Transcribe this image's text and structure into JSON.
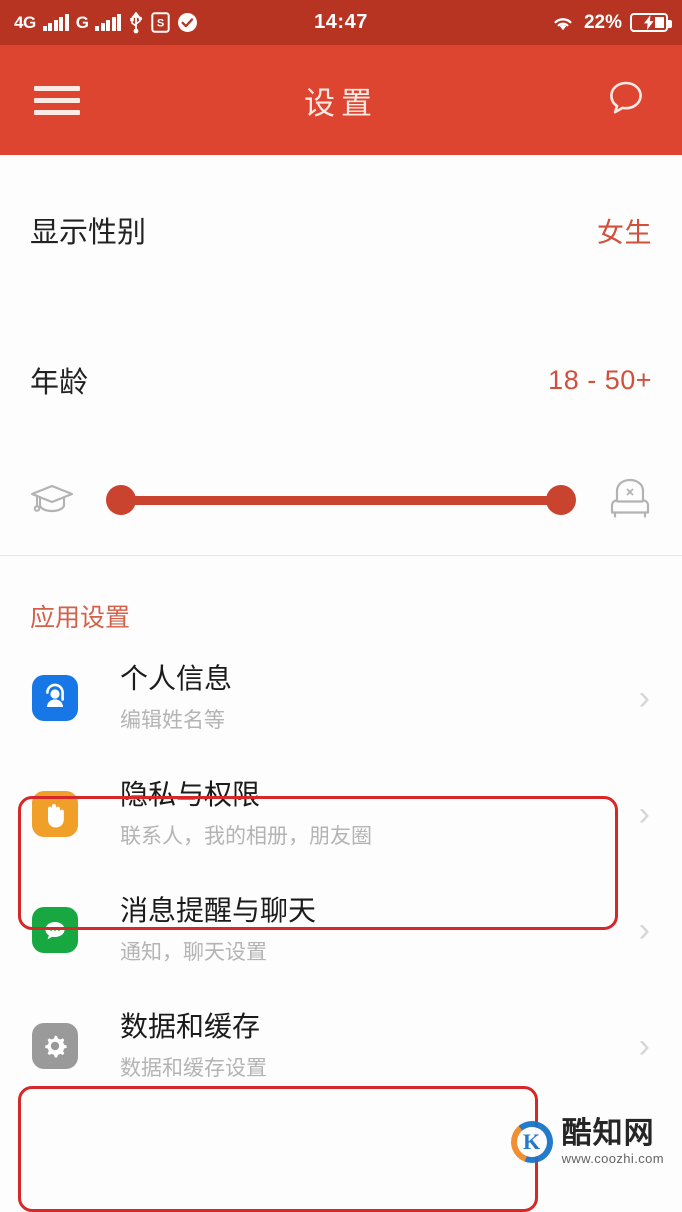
{
  "status_bar": {
    "network_primary": "4G",
    "network_secondary": "G",
    "usb_icon": "usb-icon",
    "sim_icon": "S",
    "check_icon": "check-circle-icon",
    "clock": "14:47",
    "wifi_icon": "wifi-icon",
    "battery_percent": "22%",
    "battery_state": "charging"
  },
  "app_bar": {
    "menu_icon": "hamburger-menu-icon",
    "title": "设置",
    "chat_icon": "chat-bubble-icon"
  },
  "preferences": {
    "gender": {
      "label": "显示性别",
      "value": "女生"
    },
    "age": {
      "label": "年龄",
      "value": "18 - 50+"
    },
    "age_slider": {
      "left_icon": "graduation-cap-icon",
      "right_icon": "armchair-icon",
      "min_position_pct": 0,
      "max_position_pct": 100
    }
  },
  "app_settings": {
    "section_title": "应用设置",
    "items": [
      {
        "title": "个人信息",
        "subtitle": "编辑姓名等",
        "icon": "person-icon",
        "icon_color": "#1877e6",
        "highlighted": false
      },
      {
        "title": "隐私与权限",
        "subtitle": "联系人，我的相册，朋友圈",
        "icon": "hand-stop-icon",
        "icon_color": "#f0a028",
        "highlighted": true
      },
      {
        "title": "消息提醒与聊天",
        "subtitle": "通知，聊天设置",
        "icon": "speech-bubble-icon",
        "icon_color": "#17a842",
        "highlighted": false
      },
      {
        "title": "数据和缓存",
        "subtitle": "数据和缓存设置",
        "icon": "gear-icon",
        "icon_color": "#9a9a9a",
        "highlighted": true
      }
    ],
    "chevron": "›"
  },
  "watermark": {
    "logo_letter": "K",
    "name": "酷知网",
    "url": "www.coozhi.com"
  },
  "colors": {
    "status_bar": "#b73322",
    "app_bar": "#dd4530",
    "accent": "#d0503c",
    "highlight_box": "#d62828"
  }
}
